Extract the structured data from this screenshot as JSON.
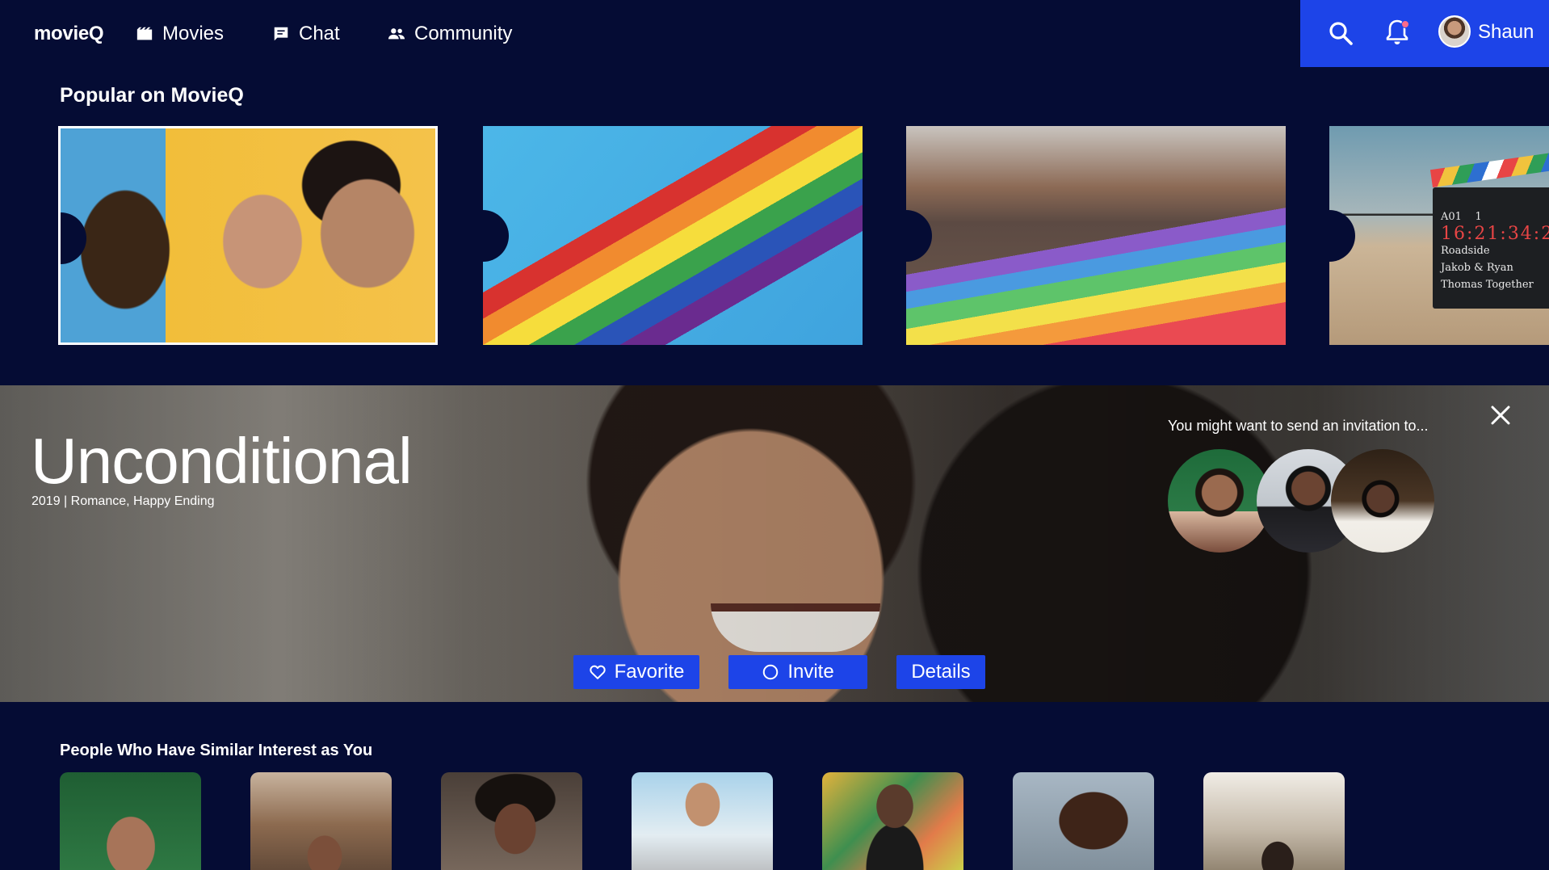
{
  "nav": {
    "logo": "movieQ",
    "items": [
      {
        "label": "Movies",
        "icon": "movie-clapper-icon"
      },
      {
        "label": "Chat",
        "icon": "chat-bubble-icon"
      },
      {
        "label": "Community",
        "icon": "people-icon"
      }
    ],
    "user_name": "Shaun",
    "has_notification": true,
    "accent_color": "#1d44e8"
  },
  "popular": {
    "title": "Popular on MovieQ",
    "posters": [
      {
        "subject": "two men kissing",
        "selected": true
      },
      {
        "subject": "rainbow pride flags",
        "selected": false
      },
      {
        "subject": "pride parade with rainbow banner",
        "selected": false
      },
      {
        "subject": "film clapperboard on beach",
        "selected": false
      }
    ],
    "clapper": {
      "roll": "A01",
      "scene": "1",
      "timecode": "16:21:34:2",
      "line1": "Roadside",
      "line2": "Jakob & Ryan",
      "line3": "Thomas  Together"
    }
  },
  "hero": {
    "title": "Unconditional",
    "meta": "2019 | Romance, Happy Ending",
    "invite_hint": "You might want to send an invitation to...",
    "buttons": {
      "favorite": "Favorite",
      "invite": "Invite",
      "details": "Details"
    }
  },
  "people": {
    "title": "People Who Have Similar Interest as You",
    "count": 7
  }
}
